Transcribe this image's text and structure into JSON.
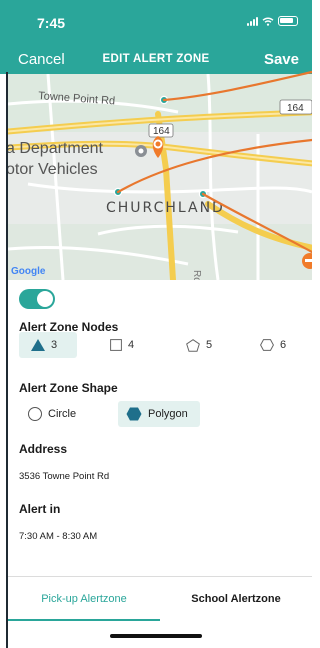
{
  "status_bar": {
    "time": "7:45"
  },
  "nav": {
    "cancel_label": "Cancel",
    "title": "EDIT ALERT ZONE",
    "save_label": "Save"
  },
  "map": {
    "labels": {
      "street": "Towne Point Rd",
      "route_badge": "164",
      "route_badge_right": "164",
      "place_line1": "a Department",
      "place_line2": "otor Vehicles",
      "neighborhood": "CHURCHLAND",
      "road_vertical": "Rd",
      "attribution": "Google"
    }
  },
  "alert_zone": {
    "enabled": true,
    "nodes_label": "Alert Zone Nodes",
    "node_options": [
      "3",
      "4",
      "5",
      "6"
    ],
    "selected_nodes": "3",
    "shape_label": "Alert Zone Shape",
    "shape_options": {
      "circle": "Circle",
      "polygon": "Polygon"
    },
    "selected_shape": "Polygon",
    "address_label": "Address",
    "address_value": "3536 Towne Point Rd",
    "alert_in_label": "Alert in",
    "alert_in_value": "7:30 AM - 8:30 AM"
  },
  "tabs": {
    "pickup": "Pick-up Alertzone",
    "school": "School Alertzone",
    "active": "pickup"
  },
  "colors": {
    "accent": "#2aa69a",
    "callout": "#e8772e",
    "road_major": "#f2c94c",
    "pin": "#f07b2a"
  }
}
